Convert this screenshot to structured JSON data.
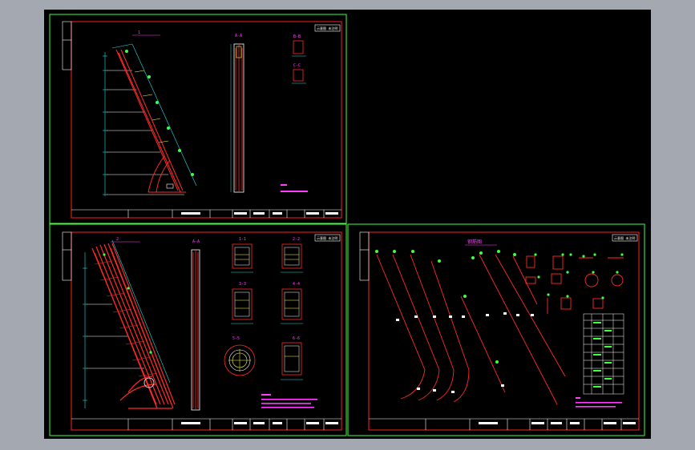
{
  "colors": {
    "background": "#000000",
    "frame": "#3fff3f",
    "border": "#ff2020",
    "line": "#ff2a2a",
    "cyan": "#22e0e0",
    "magenta": "#ff3cff",
    "yellow": "#ffff40",
    "white": "#ffffff",
    "green": "#40ff40",
    "outer": "#a4a9b1"
  },
  "sheet1": {
    "view_title": "1",
    "elevation_title": "A-A",
    "section_b_title": "B-B",
    "section_c_title": "C-C",
    "stamp": "示意图 未注明"
  },
  "sheet2": {
    "view_title": "2",
    "elevation_title": "A-A",
    "sec1": "1-1",
    "sec2": "2-2",
    "sec3": "3-3",
    "sec4": "4-4",
    "sec5": "5-5",
    "sec6": "6-6",
    "stamp": "示意图 未注明"
  },
  "sheet3": {
    "title": "钢筋图",
    "stamp": "示意图 未注明"
  }
}
